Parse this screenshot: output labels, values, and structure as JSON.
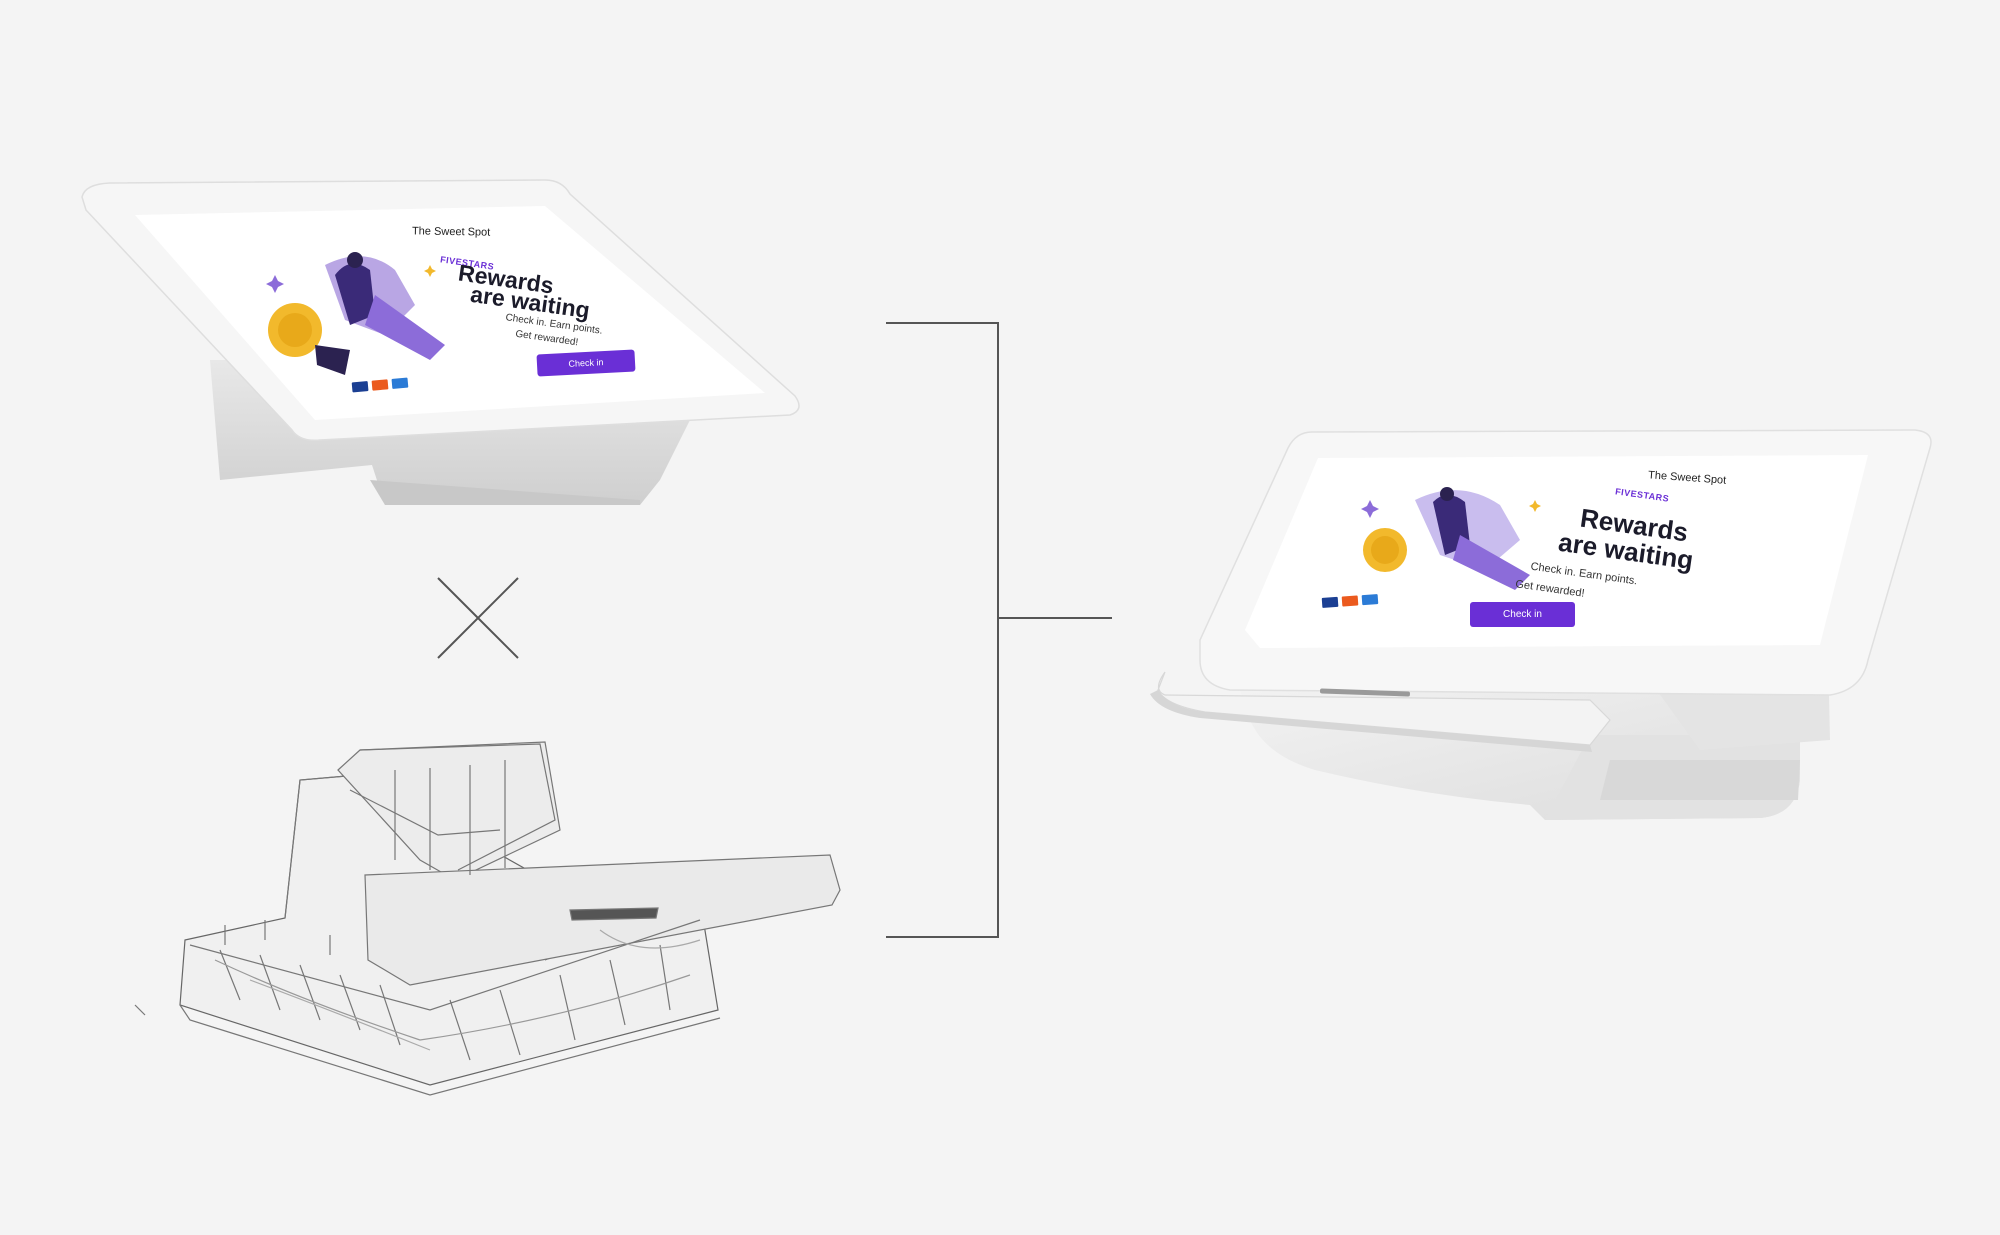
{
  "kiosk": {
    "store_name": "The Sweet Spot",
    "brand": "FIVESTARS",
    "headline_line1": "Rewards",
    "headline_line2": "are waiting",
    "sub_line1": "Check in. Earn points.",
    "sub_line2": "Get rewarded!",
    "cta_label": "Check in"
  },
  "colors": {
    "background": "#f4f4f4",
    "brand_purple": "#6a2fd6",
    "device_white": "#ececec",
    "line": "#555555"
  },
  "icons": [
    "sparkle-icon",
    "visa-card-icon",
    "mastercard-icon",
    "amex-card-icon",
    "multiply-icon"
  ]
}
